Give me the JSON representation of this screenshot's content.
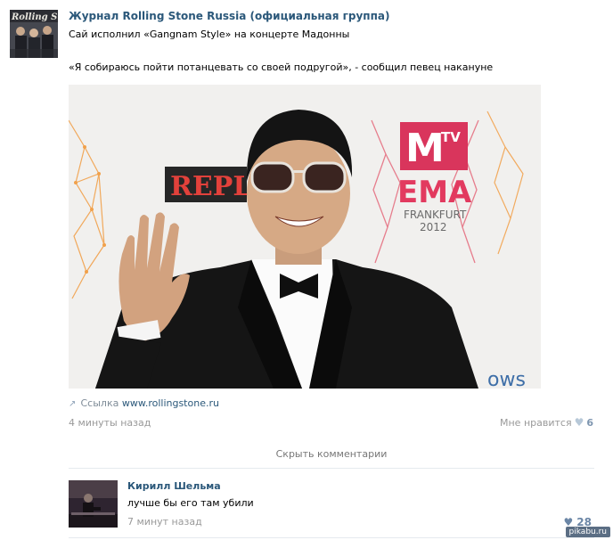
{
  "post": {
    "author": "Журнал Rolling Stone Russia (официальная группа)",
    "text_line1": "Сай исполнил «Gangnam Style» на концерте Мадонны",
    "text_line2": "«Я собираюсь пойти потанцевать со своей подругой», - сообщил певец накануне",
    "avatar_logo": "Rolling Stone",
    "photo": {
      "backdrop_repl": "REPL",
      "backdrop_mtv": "M",
      "backdrop_tv": "TV",
      "backdrop_ema": "EMA",
      "backdrop_city": "FRANKFURT",
      "backdrop_year": "2012",
      "backdrop_ows": "ows"
    },
    "link_label": "Ссылка",
    "link_url": "www.rollingstone.ru",
    "time": "4 минуты назад",
    "like_label": "Мне нравится",
    "like_count": "6"
  },
  "comments_toggle": "Скрыть комментарии",
  "comment": {
    "author": "Кирилл Шельма",
    "text": "лучше бы его там убили",
    "time": "7 минут назад",
    "like_count": "28"
  },
  "watermark": "pikabu.ru",
  "colors": {
    "link": "#2b587a",
    "muted": "#999999",
    "mtv_pink": "#d9355c",
    "ema_pink": "#e23a5f"
  }
}
